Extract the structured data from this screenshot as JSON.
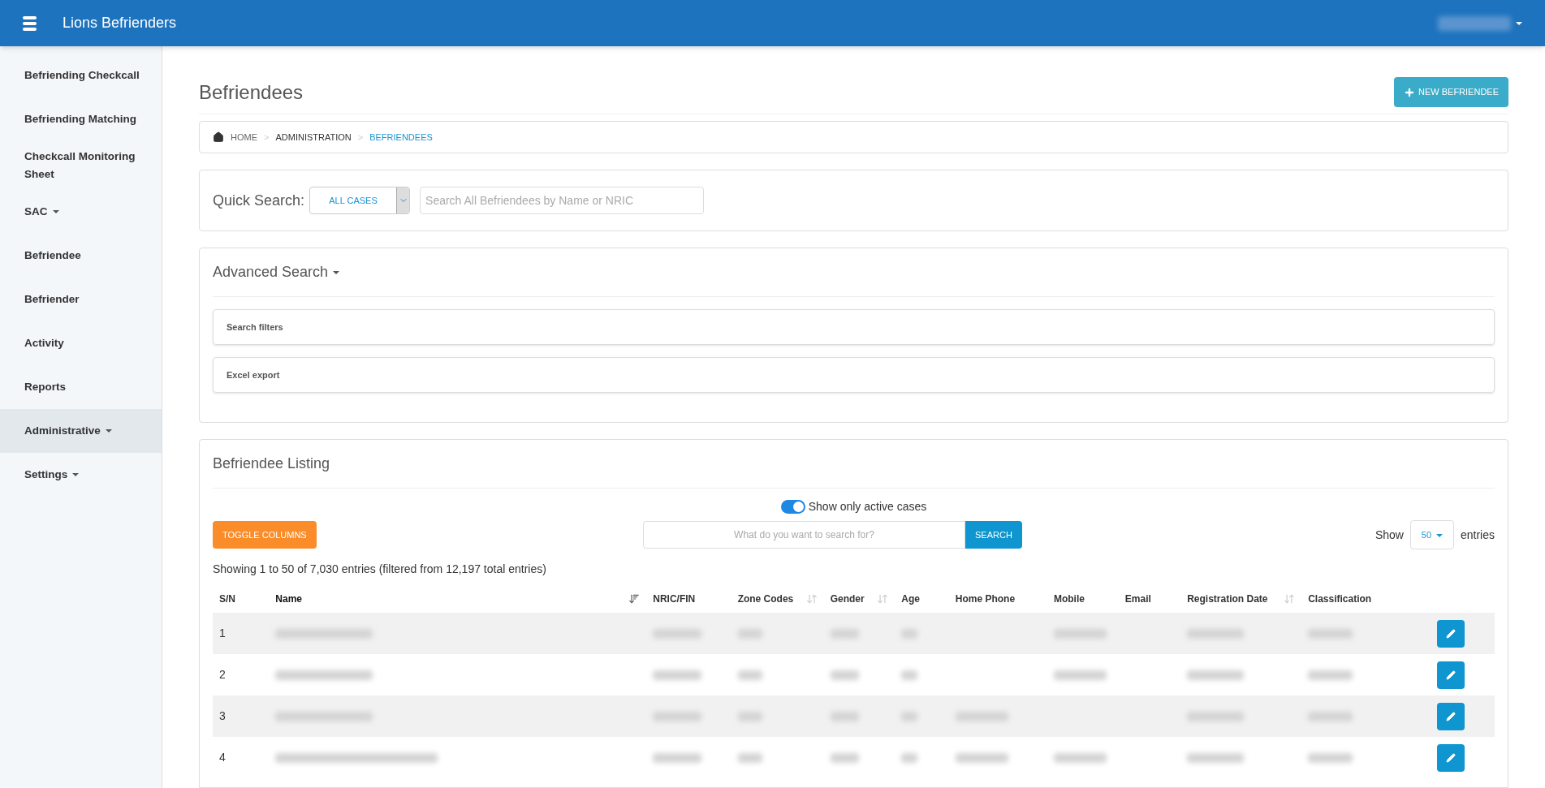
{
  "app": {
    "title": "Lions Befrienders"
  },
  "sidebar": {
    "items": [
      {
        "label": "Befriending Checkcall",
        "has_menu": false,
        "selected": false
      },
      {
        "label": "Befriending Matching",
        "has_menu": false,
        "selected": false
      },
      {
        "label": "Checkcall Monitoring Sheet",
        "has_menu": false,
        "selected": false
      },
      {
        "label": "SAC",
        "has_menu": true,
        "selected": false
      },
      {
        "label": "Befriendee",
        "has_menu": false,
        "selected": false
      },
      {
        "label": "Befriender",
        "has_menu": false,
        "selected": false
      },
      {
        "label": "Activity",
        "has_menu": false,
        "selected": false
      },
      {
        "label": "Reports",
        "has_menu": false,
        "selected": false
      },
      {
        "label": "Administrative",
        "has_menu": true,
        "selected": true
      },
      {
        "label": "Settings",
        "has_menu": true,
        "selected": false
      }
    ]
  },
  "page": {
    "title": "Befriendees",
    "new_button": "NEW BEFRIENDEE"
  },
  "breadcrumb": [
    {
      "label": "HOME",
      "selected": false
    },
    {
      "separator": ">",
      "label": "ADMINISTRATION",
      "selected": false
    },
    {
      "separator": ">",
      "label": "BEFRIENDEES",
      "selected": true
    }
  ],
  "quick_search": {
    "label": "Quick Search:",
    "scope": "ALL CASES",
    "placeholder": "Search All Befriendees by Name or NRIC"
  },
  "advanced_search": {
    "title": "Advanced Search",
    "sections": [
      "Search filters",
      "Excel export"
    ]
  },
  "listing": {
    "title": "Befriendee Listing",
    "active_toggle": {
      "label": "Show only active cases",
      "on": true
    },
    "toggle_columns": "TOGGLE COLUMNS",
    "search": {
      "placeholder": "What do you want to search for?",
      "button": "SEARCH"
    },
    "page_size": {
      "prefix": "Show",
      "value": "50",
      "suffix": "entries"
    },
    "summary": "Showing 1 to 50 of 7,030 entries (filtered from 12,197 total entries)",
    "columns": [
      {
        "label": "S/N",
        "sortable": false,
        "sorted": false
      },
      {
        "label": "Name",
        "sortable": true,
        "sorted": true
      },
      {
        "label": "NRIC/FIN",
        "sortable": false,
        "sorted": false
      },
      {
        "label": "Zone Codes",
        "sortable": true,
        "sorted": false
      },
      {
        "label": "Gender",
        "sortable": true,
        "sorted": false
      },
      {
        "label": "Age",
        "sortable": false,
        "sorted": false
      },
      {
        "label": "Home Phone",
        "sortable": false,
        "sorted": false
      },
      {
        "label": "Mobile",
        "sortable": false,
        "sorted": false
      },
      {
        "label": "Email",
        "sortable": false,
        "sorted": false
      },
      {
        "label": "Registration Date",
        "sortable": true,
        "sorted": false
      },
      {
        "label": "Classification",
        "sortable": false,
        "sorted": false
      }
    ],
    "rows": [
      {
        "sn": "1",
        "redacted": [
          true,
          true,
          true,
          true,
          true,
          false,
          true,
          false,
          true,
          true
        ]
      },
      {
        "sn": "2",
        "redacted": [
          true,
          true,
          true,
          true,
          true,
          false,
          true,
          false,
          true,
          true
        ]
      },
      {
        "sn": "3",
        "redacted": [
          true,
          true,
          true,
          true,
          true,
          true,
          false,
          false,
          true,
          true
        ]
      },
      {
        "sn": "4",
        "redacted": [
          true,
          true,
          true,
          true,
          true,
          true,
          true,
          false,
          true,
          true
        ]
      }
    ]
  }
}
